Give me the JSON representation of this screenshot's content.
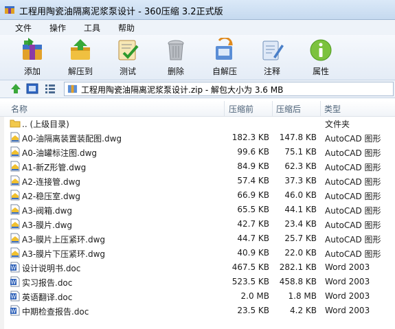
{
  "window": {
    "title": "工程用陶瓷油隔离泥浆泵设计 - 360压缩 3.2正式版"
  },
  "menu": [
    "文件",
    "操作",
    "工具",
    "帮助"
  ],
  "toolbar": [
    {
      "label": "添加",
      "icon": "add-icon"
    },
    {
      "label": "解压到",
      "icon": "extract-icon"
    },
    {
      "label": "测试",
      "icon": "test-icon"
    },
    {
      "label": "删除",
      "icon": "delete-icon"
    },
    {
      "label": "自解压",
      "icon": "sfx-icon"
    },
    {
      "label": "注释",
      "icon": "comment-icon"
    },
    {
      "label": "属性",
      "icon": "info-icon"
    }
  ],
  "address": {
    "text": "工程用陶瓷油隔离泥浆泵设计.zip - 解包大小为 3.6 MB"
  },
  "columns": {
    "name": "名称",
    "size": "压缩前",
    "csize": "压缩后",
    "type": "类型"
  },
  "files": [
    {
      "name": ".. (上级目录)",
      "size": "",
      "csize": "",
      "type": "文件夹",
      "kind": "folder"
    },
    {
      "name": "A0-油隔离装置装配图.dwg",
      "size": "182.3 KB",
      "csize": "147.8 KB",
      "type": "AutoCAD 图形",
      "kind": "dwg"
    },
    {
      "name": "A0-油罐标注图.dwg",
      "size": "99.6 KB",
      "csize": "75.1 KB",
      "type": "AutoCAD 图形",
      "kind": "dwg"
    },
    {
      "name": "A1-新Z形管.dwg",
      "size": "84.9 KB",
      "csize": "62.3 KB",
      "type": "AutoCAD 图形",
      "kind": "dwg"
    },
    {
      "name": "A2-连接管.dwg",
      "size": "57.4 KB",
      "csize": "37.3 KB",
      "type": "AutoCAD 图形",
      "kind": "dwg"
    },
    {
      "name": "A2-稳压室.dwg",
      "size": "66.9 KB",
      "csize": "46.0 KB",
      "type": "AutoCAD 图形",
      "kind": "dwg"
    },
    {
      "name": "A3-阀箱.dwg",
      "size": "65.5 KB",
      "csize": "44.1 KB",
      "type": "AutoCAD 图形",
      "kind": "dwg"
    },
    {
      "name": "A3-膜片.dwg",
      "size": "42.7 KB",
      "csize": "23.4 KB",
      "type": "AutoCAD 图形",
      "kind": "dwg"
    },
    {
      "name": "A3-膜片上压紧环.dwg",
      "size": "44.7 KB",
      "csize": "25.7 KB",
      "type": "AutoCAD 图形",
      "kind": "dwg"
    },
    {
      "name": "A3-膜片下压紧环.dwg",
      "size": "40.9 KB",
      "csize": "22.0 KB",
      "type": "AutoCAD 图形",
      "kind": "dwg"
    },
    {
      "name": "设计说明书.doc",
      "size": "467.5 KB",
      "csize": "282.1 KB",
      "type": "Word 2003",
      "kind": "doc"
    },
    {
      "name": "实习报告.doc",
      "size": "523.5 KB",
      "csize": "458.8 KB",
      "type": "Word 2003",
      "kind": "doc"
    },
    {
      "name": "英语翻译.doc",
      "size": "2.0 MB",
      "csize": "1.8 MB",
      "type": "Word 2003",
      "kind": "doc"
    },
    {
      "name": "中期检查报告.doc",
      "size": "23.5 KB",
      "csize": "4.2 KB",
      "type": "Word 2003",
      "kind": "doc"
    }
  ]
}
